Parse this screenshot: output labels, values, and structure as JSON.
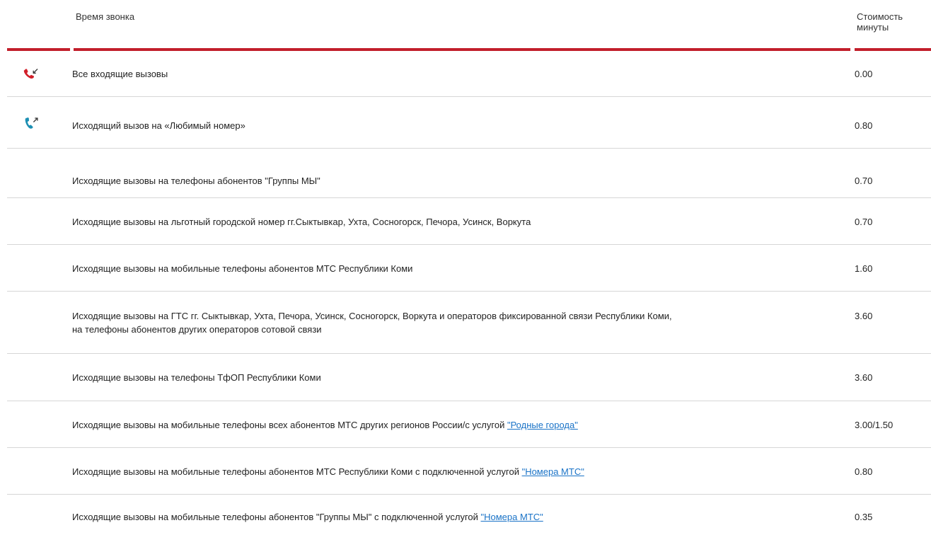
{
  "header": {
    "time_label": "Время звонка",
    "cost_label": "Стоимость минуты"
  },
  "colors": {
    "accent": "#c21f2b",
    "incoming_icon": "#d11f2a",
    "outgoing_icon": "#1c8fb3",
    "link": "#1a73c7",
    "separator": "#d6d6d6"
  },
  "rows": [
    {
      "icon": "incoming-call-icon",
      "description": "Все входящие вызовы",
      "price": "0.00"
    },
    {
      "icon": "outgoing-call-icon",
      "description": "Исходящий вызов на «Любимый номер»",
      "price": "0.80"
    },
    {
      "description": "Исходящие вызовы на телефоны абонентов \"Группы МЫ\"",
      "price": "0.70"
    },
    {
      "description": "Исходящие вызовы на льготный городской номер гг.Сыктывкар, Ухта, Сосногорск, Печора, Усинск, Воркута",
      "price": "0.70"
    },
    {
      "description": "Исходящие вызовы на мобильные телефоны абонентов МТС Республики Коми",
      "price": "1.60"
    },
    {
      "description_line1": "Исходящие вызовы на ГТС гг. Сыктывкар, Ухта, Печора, Усинск, Сосногорск, Воркута и операторов фиксированной связи Республики Коми,",
      "description_line2": "на телефоны абонентов других операторов сотовой связи",
      "price": "3.60"
    },
    {
      "description": "Исходящие вызовы на телефоны ТфОП Республики Коми",
      "price": "3.60"
    },
    {
      "description": "Исходящие вызовы на мобильные телефоны всех абонентов МТС других регионов России/с услугой ",
      "link": "\"Родные города\"",
      "price": "3.00/1.50"
    },
    {
      "description": "Исходящие вызовы на мобильные телефоны абонентов МТС Республики Коми с подключенной услугой ",
      "link": "\"Номера МТС\"",
      "price": "0.80"
    },
    {
      "description": "Исходящие вызовы на мобильные телефоны абонентов \"Группы МЫ\" с подключенной услугой ",
      "link": "\"Номера МТС\"",
      "price": "0.35"
    }
  ]
}
